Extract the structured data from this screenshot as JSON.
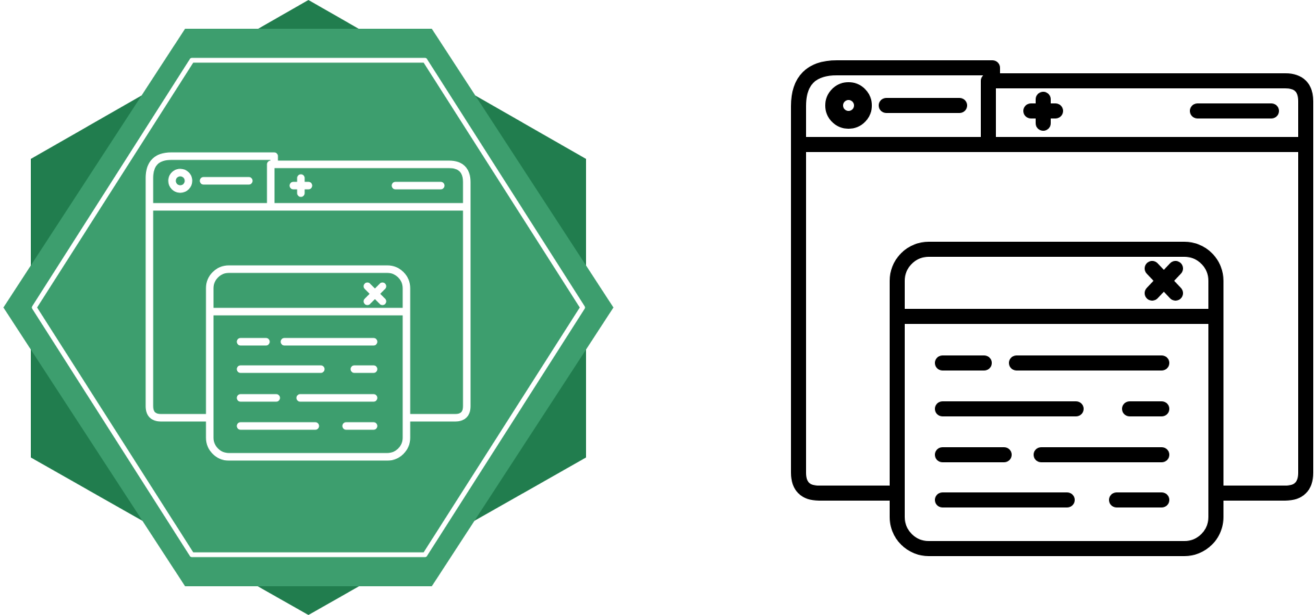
{
  "icons": [
    {
      "name": "browser-windows-badge-icon",
      "style": "filled badge",
      "colors": {
        "outer_shape": "#217D4E",
        "inner_shape": "#3D9E6E",
        "stroke": "#FFFFFF"
      }
    },
    {
      "name": "browser-windows-outline-icon",
      "style": "line",
      "colors": {
        "stroke": "#000000",
        "fill": "#FFFFFF"
      }
    }
  ]
}
